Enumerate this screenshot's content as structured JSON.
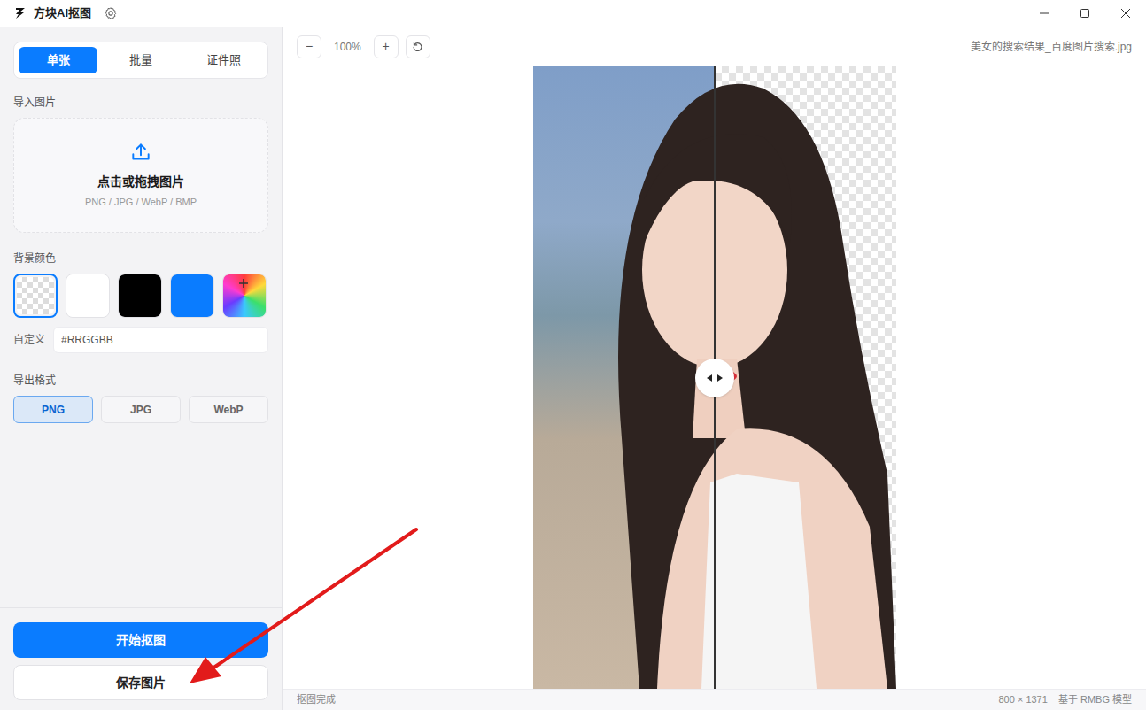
{
  "window": {
    "title": "方块AI抠图"
  },
  "tabs": [
    {
      "label": "单张",
      "selected": true
    },
    {
      "label": "批量",
      "selected": false
    },
    {
      "label": "证件照",
      "selected": false
    }
  ],
  "import": {
    "label": "导入图片",
    "prompt": "点击或拖拽图片",
    "formats": "PNG / JPG / WebP / BMP"
  },
  "background": {
    "label": "背景颜色",
    "swatches": [
      {
        "kind": "transparent",
        "selected": true
      },
      {
        "kind": "solid",
        "color": "#ffffff",
        "selected": false
      },
      {
        "kind": "solid",
        "color": "#000000",
        "selected": false
      },
      {
        "kind": "solid",
        "color": "#0a7cff",
        "selected": false
      },
      {
        "kind": "picker",
        "selected": false
      }
    ],
    "custom_label": "自定义",
    "custom_placeholder": "#RRGGBB"
  },
  "export": {
    "label": "导出格式",
    "formats": [
      {
        "label": "PNG",
        "selected": true
      },
      {
        "label": "JPG",
        "selected": false
      },
      {
        "label": "WebP",
        "selected": false
      }
    ]
  },
  "actions": {
    "start": "开始抠图",
    "save": "保存图片"
  },
  "toolbar": {
    "zoom_out": "−",
    "zoom": "100%",
    "zoom_in": "+",
    "filename": "美女的搜索结果_百度图片搜索.jpg"
  },
  "preview": {
    "level": 0.5
  },
  "status_bar": {
    "left": "抠图完成",
    "size": "800 × 1371",
    "model": "基于 RMBG 模型"
  }
}
